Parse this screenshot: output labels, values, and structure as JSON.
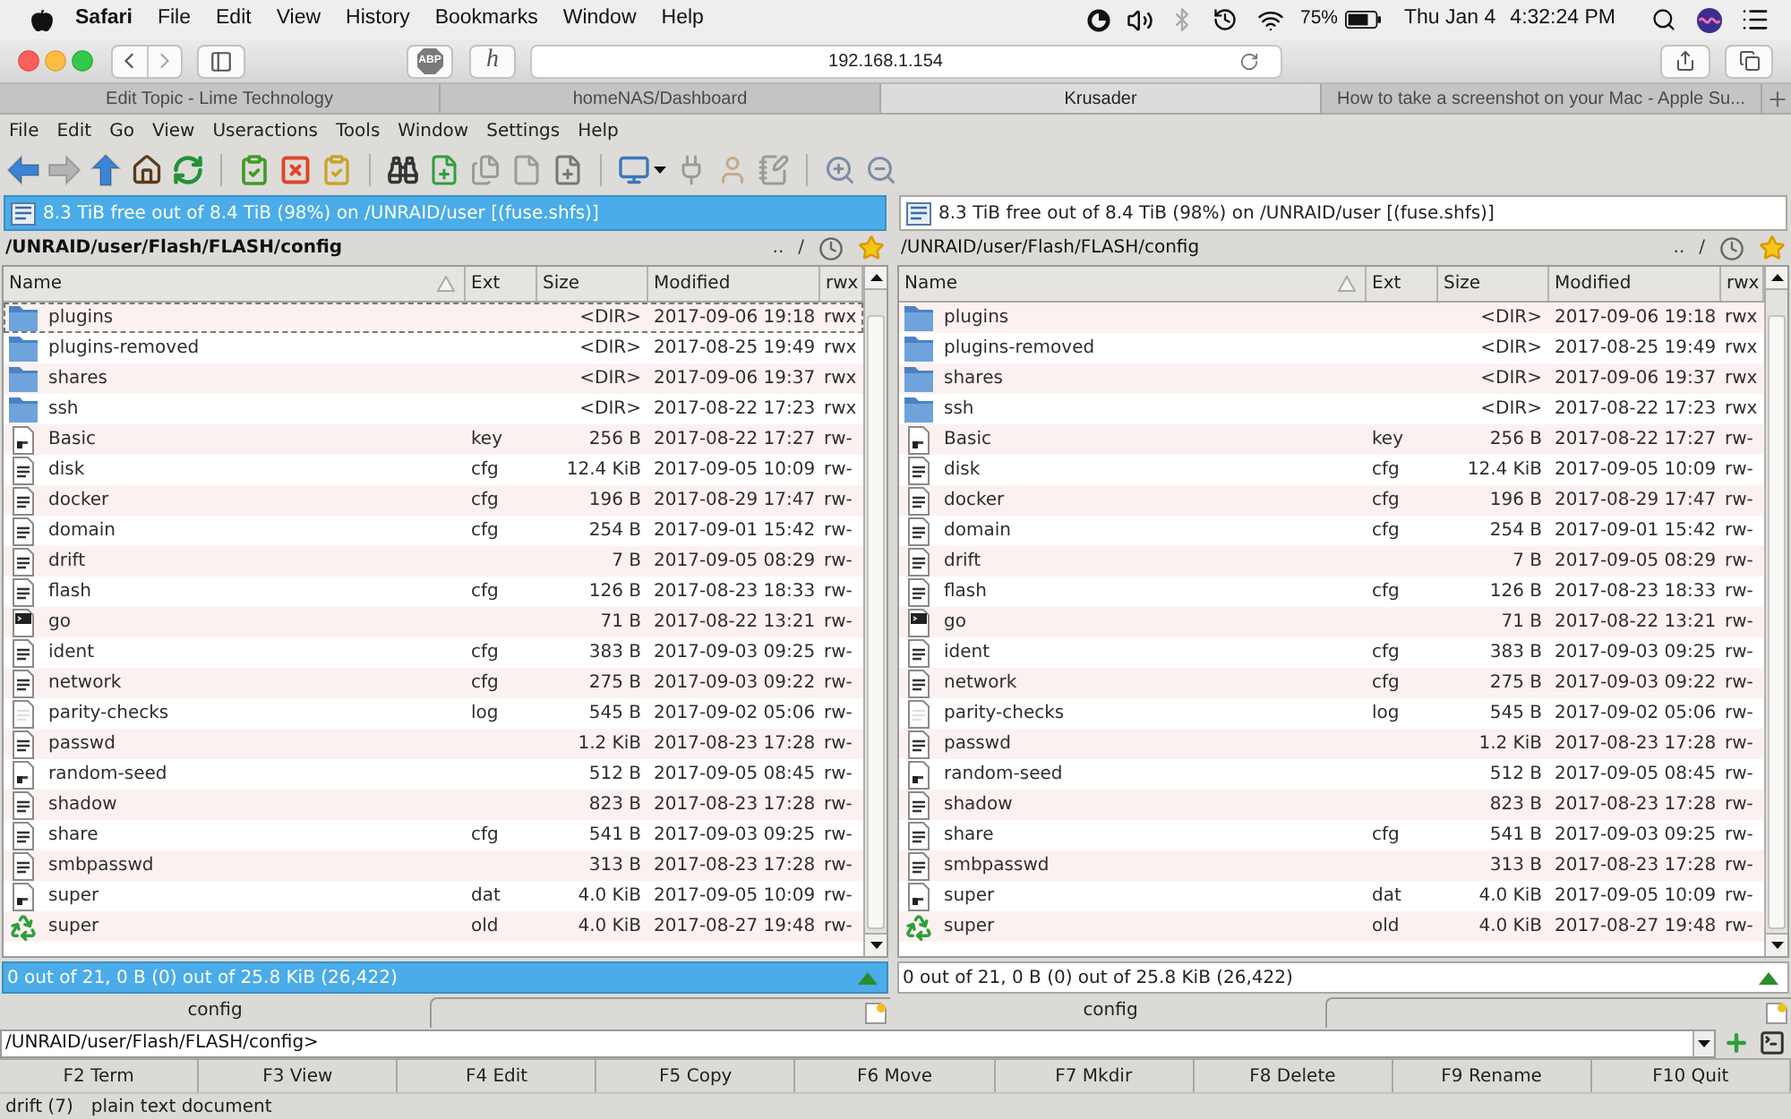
{
  "mac_menubar": {
    "app": "Safari",
    "menus": [
      "File",
      "Edit",
      "View",
      "History",
      "Bookmarks",
      "Window",
      "Help"
    ],
    "battery": "75%",
    "date": "Thu Jan 4",
    "time": "4:32:24 PM"
  },
  "browser": {
    "extension_buttons": [
      {
        "kind": "badge",
        "label": "ABP"
      },
      {
        "kind": "plain",
        "label": "h"
      }
    ],
    "url": "192.168.1.154",
    "tabs": [
      {
        "title": "Edit Topic - Lime Technology",
        "selected": false
      },
      {
        "title": "homeNAS/Dashboard",
        "selected": false
      },
      {
        "title": "Krusader",
        "selected": true
      },
      {
        "title": "How to take a screenshot on your Mac - Apple Su...",
        "selected": false
      }
    ]
  },
  "menu": [
    "File",
    "Edit",
    "Go",
    "View",
    "Useractions",
    "Tools",
    "Window",
    "Settings",
    "Help"
  ],
  "toolbar": {
    "forward_disabled": true
  },
  "panels": [
    {
      "active": true,
      "free_space": "8.3 TiB free out of 8.4 TiB (98%) on /UNRAID/user [(fuse.shfs)]",
      "path": "/UNRAID/user/Flash/FLASH/config",
      "nav": [
        "..",
        "/"
      ],
      "columns": [
        "Name",
        "Ext",
        "Size",
        "Modified",
        "rwx"
      ],
      "rows": [
        {
          "kind": "folder",
          "name": "plugins",
          "size": "<DIR>",
          "modified": "2017-09-06 19:18",
          "rwx": "rwx",
          "focused": true
        },
        {
          "kind": "folder",
          "name": "plugins-removed",
          "size": "<DIR>",
          "modified": "2017-08-25 19:49",
          "rwx": "rwx",
          "focused": false
        },
        {
          "kind": "folder",
          "name": "shares",
          "size": "<DIR>",
          "modified": "2017-09-06 19:37",
          "rwx": "rwx",
          "focused": false
        },
        {
          "kind": "folder",
          "name": "ssh",
          "size": "<DIR>",
          "modified": "2017-08-22 17:23",
          "rwx": "rwx",
          "focused": false
        },
        {
          "kind": "binary",
          "name": "Basic",
          "ext": "key",
          "size": "256 B",
          "modified": "2017-08-22 17:27",
          "rwx": "rw-",
          "focused": false
        },
        {
          "kind": "text",
          "name": "disk",
          "ext": "cfg",
          "size": "12.4 KiB",
          "modified": "2017-09-05 10:09",
          "rwx": "rw-",
          "focused": false
        },
        {
          "kind": "text",
          "name": "docker",
          "ext": "cfg",
          "size": "196 B",
          "modified": "2017-08-29 17:47",
          "rwx": "rw-",
          "focused": false
        },
        {
          "kind": "text",
          "name": "domain",
          "ext": "cfg",
          "size": "254 B",
          "modified": "2017-09-01 15:42",
          "rwx": "rw-",
          "focused": false
        },
        {
          "kind": "text",
          "name": "drift",
          "size": "7 B",
          "modified": "2017-09-05 08:29",
          "rwx": "rw-",
          "focused": false
        },
        {
          "kind": "text",
          "name": "flash",
          "ext": "cfg",
          "size": "126 B",
          "modified": "2017-08-23 18:33",
          "rwx": "rw-",
          "focused": false
        },
        {
          "kind": "script",
          "name": "go",
          "size": "71 B",
          "modified": "2017-08-22 13:21",
          "rwx": "rw-",
          "focused": false
        },
        {
          "kind": "text",
          "name": "ident",
          "ext": "cfg",
          "size": "383 B",
          "modified": "2017-09-03 09:25",
          "rwx": "rw-",
          "focused": false
        },
        {
          "kind": "text",
          "name": "network",
          "ext": "cfg",
          "size": "275 B",
          "modified": "2017-09-03 09:22",
          "rwx": "rw-",
          "focused": false
        },
        {
          "kind": "blank",
          "name": "parity-checks",
          "ext": "log",
          "size": "545 B",
          "modified": "2017-09-02 05:06",
          "rwx": "rw-",
          "focused": false
        },
        {
          "kind": "text",
          "name": "passwd",
          "size": "1.2 KiB",
          "modified": "2017-08-23 17:28",
          "rwx": "rw-",
          "focused": false
        },
        {
          "kind": "binary",
          "name": "random-seed",
          "size": "512 B",
          "modified": "2017-09-05 08:45",
          "rwx": "rw-",
          "focused": false
        },
        {
          "kind": "text",
          "name": "shadow",
          "size": "823 B",
          "modified": "2017-08-23 17:28",
          "rwx": "rw-",
          "focused": false
        },
        {
          "kind": "text",
          "name": "share",
          "ext": "cfg",
          "size": "541 B",
          "modified": "2017-09-03 09:25",
          "rwx": "rw-",
          "focused": false
        },
        {
          "kind": "text",
          "name": "smbpasswd",
          "size": "313 B",
          "modified": "2017-08-23 17:28",
          "rwx": "rw-",
          "focused": false
        },
        {
          "kind": "binary",
          "name": "super",
          "ext": "dat",
          "size": "4.0 KiB",
          "modified": "2017-09-05 10:09",
          "rwx": "rw-",
          "focused": false
        },
        {
          "kind": "recycle",
          "name": "super",
          "ext": "old",
          "size": "4.0 KiB",
          "modified": "2017-08-27 19:48",
          "rwx": "rw-",
          "focused": false
        }
      ],
      "status": "0 out of 21, 0 B (0) out of 25.8 KiB (26,422)",
      "tab": "config"
    },
    {
      "active": false,
      "free_space": "8.3 TiB free out of 8.4 TiB (98%) on /UNRAID/user [(fuse.shfs)]",
      "path": "/UNRAID/user/Flash/FLASH/config",
      "nav": [
        "..",
        "/"
      ],
      "columns": [
        "Name",
        "Ext",
        "Size",
        "Modified",
        "rwx"
      ],
      "rows": [
        {
          "kind": "folder",
          "name": "plugins",
          "size": "<DIR>",
          "modified": "2017-09-06 19:18",
          "rwx": "rwx",
          "focused": false
        },
        {
          "kind": "folder",
          "name": "plugins-removed",
          "size": "<DIR>",
          "modified": "2017-08-25 19:49",
          "rwx": "rwx",
          "focused": false
        },
        {
          "kind": "folder",
          "name": "shares",
          "size": "<DIR>",
          "modified": "2017-09-06 19:37",
          "rwx": "rwx",
          "focused": false
        },
        {
          "kind": "folder",
          "name": "ssh",
          "size": "<DIR>",
          "modified": "2017-08-22 17:23",
          "rwx": "rwx",
          "focused": false
        },
        {
          "kind": "binary",
          "name": "Basic",
          "ext": "key",
          "size": "256 B",
          "modified": "2017-08-22 17:27",
          "rwx": "rw-",
          "focused": false
        },
        {
          "kind": "text",
          "name": "disk",
          "ext": "cfg",
          "size": "12.4 KiB",
          "modified": "2017-09-05 10:09",
          "rwx": "rw-",
          "focused": false
        },
        {
          "kind": "text",
          "name": "docker",
          "ext": "cfg",
          "size": "196 B",
          "modified": "2017-08-29 17:47",
          "rwx": "rw-",
          "focused": false
        },
        {
          "kind": "text",
          "name": "domain",
          "ext": "cfg",
          "size": "254 B",
          "modified": "2017-09-01 15:42",
          "rwx": "rw-",
          "focused": false
        },
        {
          "kind": "text",
          "name": "drift",
          "size": "7 B",
          "modified": "2017-09-05 08:29",
          "rwx": "rw-",
          "focused": false
        },
        {
          "kind": "text",
          "name": "flash",
          "ext": "cfg",
          "size": "126 B",
          "modified": "2017-08-23 18:33",
          "rwx": "rw-",
          "focused": false
        },
        {
          "kind": "script",
          "name": "go",
          "size": "71 B",
          "modified": "2017-08-22 13:21",
          "rwx": "rw-",
          "focused": false
        },
        {
          "kind": "text",
          "name": "ident",
          "ext": "cfg",
          "size": "383 B",
          "modified": "2017-09-03 09:25",
          "rwx": "rw-",
          "focused": false
        },
        {
          "kind": "text",
          "name": "network",
          "ext": "cfg",
          "size": "275 B",
          "modified": "2017-09-03 09:22",
          "rwx": "rw-",
          "focused": false
        },
        {
          "kind": "blank",
          "name": "parity-checks",
          "ext": "log",
          "size": "545 B",
          "modified": "2017-09-02 05:06",
          "rwx": "rw-",
          "focused": false
        },
        {
          "kind": "text",
          "name": "passwd",
          "size": "1.2 KiB",
          "modified": "2017-08-23 17:28",
          "rwx": "rw-",
          "focused": false
        },
        {
          "kind": "binary",
          "name": "random-seed",
          "size": "512 B",
          "modified": "2017-09-05 08:45",
          "rwx": "rw-",
          "focused": false
        },
        {
          "kind": "text",
          "name": "shadow",
          "size": "823 B",
          "modified": "2017-08-23 17:28",
          "rwx": "rw-",
          "focused": false
        },
        {
          "kind": "text",
          "name": "share",
          "ext": "cfg",
          "size": "541 B",
          "modified": "2017-09-03 09:25",
          "rwx": "rw-",
          "focused": false
        },
        {
          "kind": "text",
          "name": "smbpasswd",
          "size": "313 B",
          "modified": "2017-08-23 17:28",
          "rwx": "rw-",
          "focused": false
        },
        {
          "kind": "binary",
          "name": "super",
          "ext": "dat",
          "size": "4.0 KiB",
          "modified": "2017-09-05 10:09",
          "rwx": "rw-",
          "focused": false
        },
        {
          "kind": "recycle",
          "name": "super",
          "ext": "old",
          "size": "4.0 KiB",
          "modified": "2017-08-27 19:48",
          "rwx": "rw-",
          "focused": false
        }
      ],
      "status": "0 out of 21, 0 B (0) out of 25.8 KiB (26,422)",
      "tab": "config"
    }
  ],
  "command_line": {
    "value": "/UNRAID/user/Flash/FLASH/config>"
  },
  "function_keys": [
    "F2 Term",
    "F3 View",
    "F4 Edit",
    "F5 Copy",
    "F6 Move",
    "F7 Mkdir",
    "F8 Delete",
    "F9 Rename",
    "F10 Quit"
  ],
  "status_bar": {
    "file": "drift (7)",
    "description": "plain text document"
  }
}
